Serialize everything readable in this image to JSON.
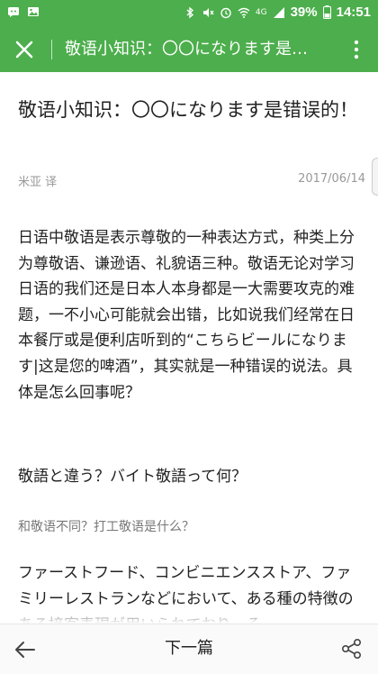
{
  "status_bar": {
    "battery": "39%",
    "time": "14:51",
    "network": "4G"
  },
  "app_bar": {
    "title": "敬语小知识：〇〇になります是错误的！"
  },
  "article": {
    "title": "敬语小知识：〇〇になります是错误的！",
    "author": "米亚 译",
    "date": "2017/06/14",
    "paragraphs": [
      "日语中敬语是表示尊敬的一种表达方式，种类上分为尊敬语、谦逊语、礼貌语三种。敬语无论对学习日语的我们还是日本人本身都是一大需要攻克的难题，一不小心可能就会出错，比如说我们经常在日本餐厅或是便利店听到的“こちらビールになります|这是您的啤酒”，其实就是一种错误的说法。具体是怎么回事呢？",
      "敬語と違う？バイト敬語って何？",
      "和敬语不同？打工敬语是什么？",
      "ファーストフード、コンビニエンスストア、ファミリーレストランなどにおいて、ある種の特徴のある接客表現が用いられており、そ"
    ]
  },
  "bottom_bar": {
    "next_label": "下一篇"
  },
  "colors": {
    "brand_green": "#4cae4c"
  }
}
